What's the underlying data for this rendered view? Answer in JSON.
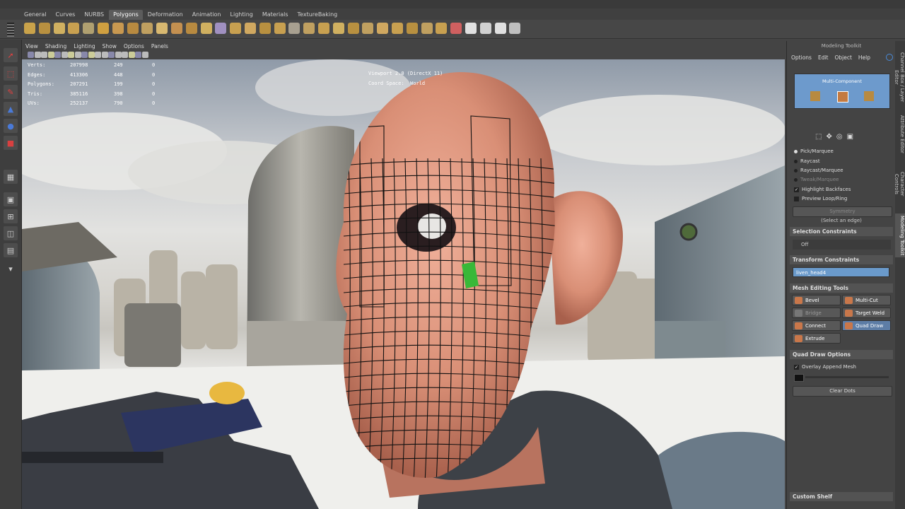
{
  "shelf_tabs": [
    "General",
    "Curves",
    "NURBS",
    "Polygons",
    "Deformation",
    "Animation",
    "Lighting",
    "Materials",
    "TextureBaking"
  ],
  "active_shelf_tab": "Polygons",
  "viewport_menu": [
    "View",
    "Shading",
    "Lighting",
    "Show",
    "Options",
    "Panels"
  ],
  "hud": {
    "rows": [
      {
        "label": "Verts:",
        "total": "207998",
        "sel": "249",
        "comp": "0"
      },
      {
        "label": "Edges:",
        "total": "413306",
        "sel": "448",
        "comp": "0"
      },
      {
        "label": "Polygons:",
        "total": "207291",
        "sel": "199",
        "comp": "0"
      },
      {
        "label": "Tris:",
        "total": "385116",
        "sel": "398",
        "comp": "0"
      },
      {
        "label": "UVs:",
        "total": "252137",
        "sel": "790",
        "comp": "0"
      }
    ],
    "viewport_label": "Viewport 2.0 (DirectX 11)",
    "coord_label": "Coord Space:",
    "coord_value": "World"
  },
  "toolkit": {
    "title": "Modeling Toolkit",
    "menu": [
      "Options",
      "Edit",
      "Object",
      "Help"
    ],
    "multi_component": "Multi-Component",
    "pick_modes": [
      {
        "label": "Pick/Marquee",
        "on": true
      },
      {
        "label": "Raycast",
        "on": false
      },
      {
        "label": "Raycast/Marquee",
        "on": false
      },
      {
        "label": "Tweak/Marquee",
        "on": false
      }
    ],
    "checks": [
      {
        "label": "Highlight Backfaces",
        "checked": true
      },
      {
        "label": "Preview Loop/Ring",
        "checked": false
      }
    ],
    "symmetry": "Symmetry",
    "select_hint": "(Select an edge)",
    "selection_constraints": "Selection Constraints",
    "selection_constraint_value": "Off",
    "transform_constraints": "Transform Constraints",
    "transform_field": "liven_head4",
    "mesh_editing_tools": "Mesh Editing Tools",
    "tools": [
      "Bevel",
      "Multi-Cut",
      "Bridge",
      "Target Weld",
      "Connect",
      "Quad Draw",
      "Extrude"
    ],
    "active_tool": "Quad Draw",
    "quad_draw_options": "Quad Draw Options",
    "overlay_append": "Overlay Append Mesh",
    "clear_dots": "Clear Dots",
    "custom_shelf": "Custom Shelf"
  },
  "side_tabs": [
    "Channel Box / Layer Editor",
    "Attribute Editor",
    "Character Controls",
    "Modeling Toolkit"
  ],
  "colors": {
    "accent": "#5d7da6",
    "panel": "#444444",
    "skin": "#d98f76"
  }
}
